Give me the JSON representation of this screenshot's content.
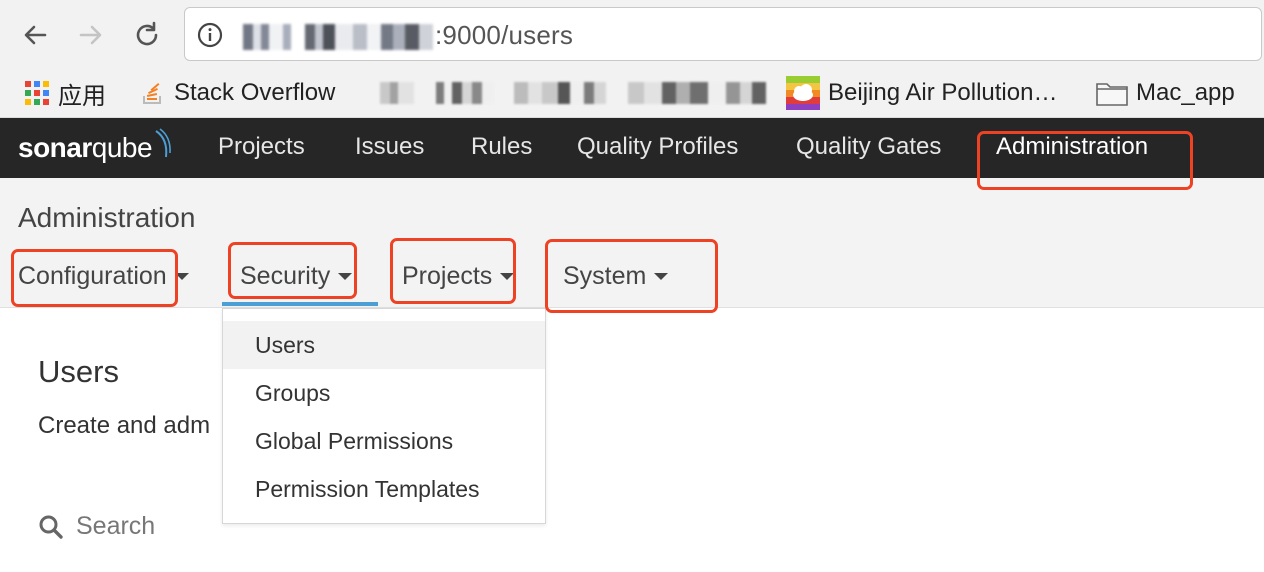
{
  "browser": {
    "url_suffix": ":9000/users",
    "bookmarks": {
      "apps_label": "应用",
      "stackoverflow_label": "Stack Overflow",
      "beijing_label": "Beijing Air Pollution…",
      "mac_app_label": "Mac_app"
    }
  },
  "sonarqube": {
    "logo_text_1": "sonar",
    "logo_text_2": "qube",
    "nav": {
      "projects": "Projects",
      "issues": "Issues",
      "rules": "Rules",
      "quality_profiles": "Quality Profiles",
      "quality_gates": "Quality Gates",
      "administration": "Administration"
    }
  },
  "admin": {
    "title": "Administration",
    "tabs": {
      "configuration": "Configuration",
      "security": "Security",
      "projects": "Projects",
      "system": "System"
    },
    "active_tab": "Security"
  },
  "security_menu": {
    "items": [
      "Users",
      "Groups",
      "Global Permissions",
      "Permission Templates"
    ],
    "active_item": "Users"
  },
  "page": {
    "title": "Users",
    "description": "Create and adm",
    "search_placeholder": "Search"
  },
  "colors": {
    "highlight": "#ee4224",
    "nav_bg": "#262626",
    "active_underline": "#4b9fd5"
  },
  "icons": [
    "back-arrow-icon",
    "forward-arrow-icon",
    "reload-icon",
    "info-icon",
    "apps-grid-icon",
    "stackoverflow-icon",
    "folder-icon",
    "search-icon",
    "caret-down-icon"
  ]
}
